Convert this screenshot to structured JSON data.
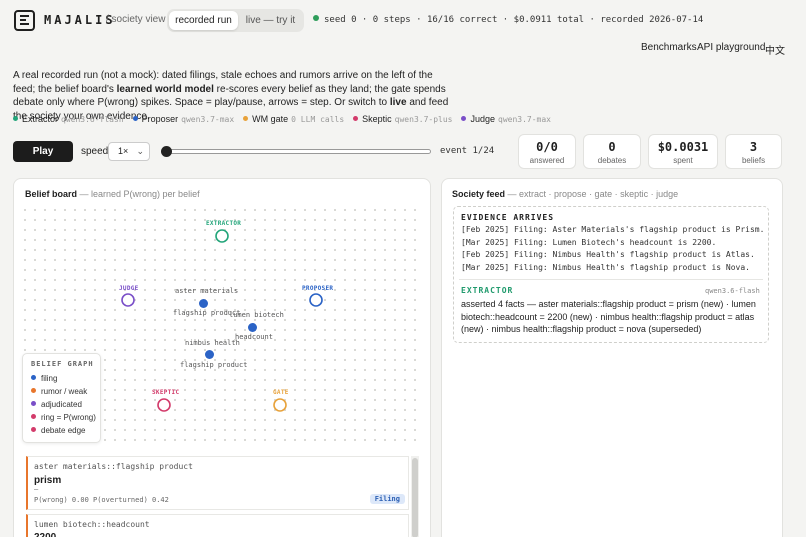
{
  "app": {
    "brand": "MAJALIS",
    "subview": "/ society view",
    "modes": [
      "recorded run",
      "live — try it"
    ],
    "status": "seed 0 · 0 steps · 16/16 correct · $0.0911 total · recorded 2026-07-14"
  },
  "nav": {
    "benchmarks": "Benchmarks",
    "api": "API playground",
    "lang": "中文"
  },
  "intro": {
    "p1": "A real recorded run (not a mock): dated filings, stale echoes and rumors arrive on the left of the feed; the belief board's ",
    "b1": "learned world model",
    "p2": " re-scores every belief as they land; the gate spends debate only where P(wrong) spikes. Space = play/pause, arrows = step. Or switch to ",
    "b2": "live",
    "p3": " and feed the society your own evidence."
  },
  "agents": [
    {
      "name": "Extractor",
      "model": "qwen3.6-flash",
      "color": "#23a57a"
    },
    {
      "name": "Proposer",
      "model": "qwen3.7-max",
      "color": "#2b63c6"
    },
    {
      "name": "WM gate",
      "model": "0 LLM calls",
      "color": "#e8a23a"
    },
    {
      "name": "Skeptic",
      "model": "qwen3.7-plus",
      "color": "#d33b6b"
    },
    {
      "name": "Judge",
      "model": "qwen3.7-max",
      "color": "#7a4fc8"
    }
  ],
  "controls": {
    "play": "Play",
    "speed_label": "speed",
    "speed_value": "1×",
    "event": "event 1/24",
    "progress": 0.0417
  },
  "stats": [
    {
      "value": "0/0",
      "label": "answered"
    },
    {
      "value": "0",
      "label": "debates"
    },
    {
      "value": "$0.0031",
      "label": "spent"
    },
    {
      "value": "3",
      "label": "beliefs"
    }
  ],
  "belief_board": {
    "title": "Belief board",
    "subtitle": " — learned P(wrong) per belief",
    "nodes": {
      "extractor": "EXTRACTOR",
      "judge": "JUDGE",
      "proposer": "PROPOSER",
      "skeptic": "SKEPTIC",
      "gate": "GATE"
    },
    "facts": [
      {
        "entity": "aster materials",
        "attr": "flagship product"
      },
      {
        "entity": "lumen biotech",
        "attr": "headcount"
      },
      {
        "entity": "nimbus health",
        "attr": "flagship product"
      }
    ],
    "legend": {
      "title": "BELIEF GRAPH",
      "items": [
        {
          "label": "filing",
          "color": "#2b63c6"
        },
        {
          "label": "rumor / weak",
          "color": "#e8762c"
        },
        {
          "label": "adjudicated",
          "color": "#7a4fc8"
        },
        {
          "label": "ring = P(wrong)",
          "color": "#d33b6b"
        },
        {
          "label": "debate edge",
          "color": "#d33b6b"
        }
      ]
    },
    "cards": [
      {
        "key": "aster materials::flagship product",
        "value": "prism",
        "dash": "—",
        "meta": "P(wrong) 0.00  P(overturned) 0.42",
        "badge": "Filing"
      },
      {
        "key": "lumen biotech::headcount",
        "value": "2200"
      }
    ]
  },
  "feed": {
    "title": "Society feed",
    "subtitle": " — extract · propose · gate · skeptic · judge",
    "evidence_title": "EVIDENCE ARRIVES",
    "evidence": [
      "[Feb 2025] Filing: Aster Materials's flagship product is Prism.",
      "[Mar 2025] Filing: Lumen Biotech's headcount is 2200.",
      "[Feb 2025] Filing: Nimbus Health's flagship product is Atlas.",
      "[Mar 2025] Filing: Nimbus Health's flagship product is Nova."
    ],
    "agent": "EXTRACTOR",
    "agent_model": "qwen3.6-flash",
    "agent_text": "asserted 4 facts — aster materials::flagship product = prism (new) · lumen biotech::headcount = 2200 (new) · nimbus health::flagship product = atlas (new) · nimbus health::flagship product = nova (superseded)"
  }
}
